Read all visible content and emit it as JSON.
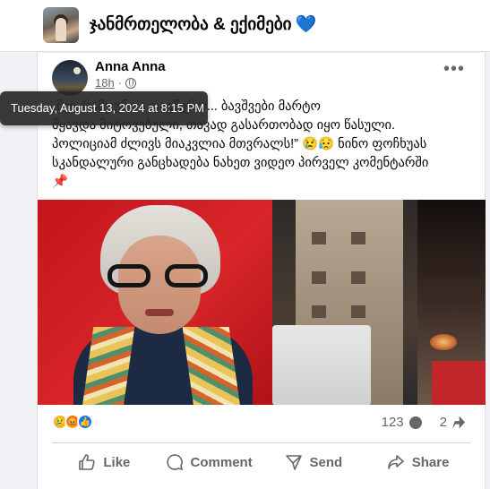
{
  "group": {
    "title": "ჯანმრთელობა & ექიმები",
    "heart_icon": "blue-heart-icon"
  },
  "post": {
    "author": "Anna Anna",
    "time": "18h",
    "privacy_icon": "globe-icon",
    "tooltip": "Tuesday, August 13, 2024 at 8:15 PM",
    "text_lines": [
      "„მეც რამე უნდა დავწერო... ბავშვები მარტო",
      "მყავდა მიტოვებული, თავად გასართობად იყო წასული.",
      "პოლიციამ ძლივს მიაკვლია მთვრალს!” 😢😥 ნინო ფოჩხუას",
      "სკანდალური განცხადება ნახეთ ვიდეო პირველ კომენტარში",
      "📌"
    ]
  },
  "reactions": [
    "sad",
    "angry",
    "like"
  ],
  "stats": {
    "comments": "123",
    "shares": "2"
  },
  "actions": {
    "like": "Like",
    "comment": "Comment",
    "send": "Send",
    "share": "Share"
  }
}
